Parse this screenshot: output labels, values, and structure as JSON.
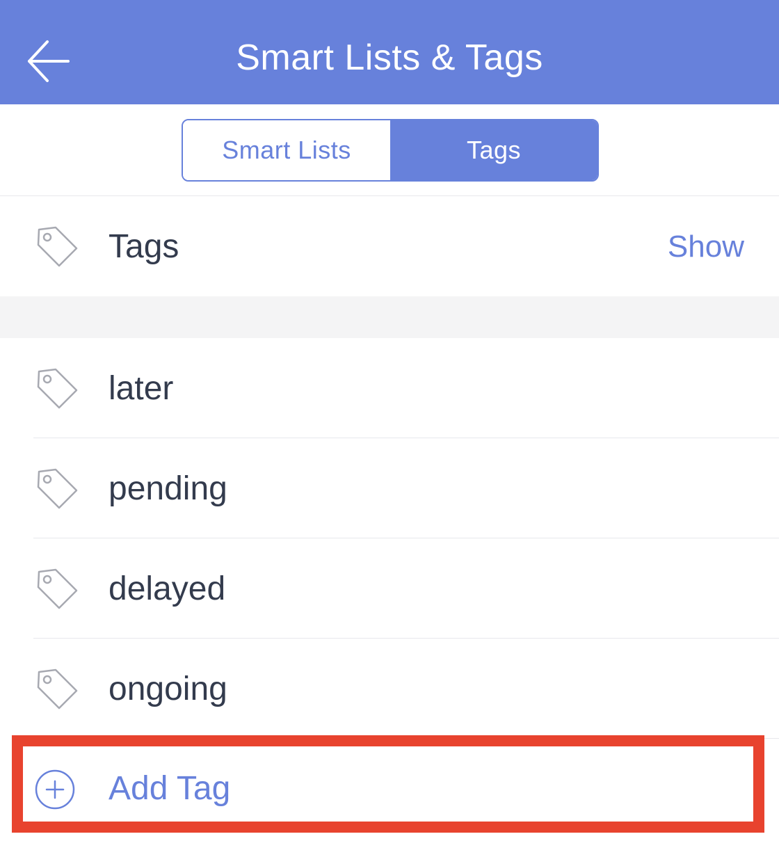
{
  "header": {
    "title": "Smart Lists & Tags",
    "back_icon": "arrow-left-icon",
    "background_color": "#6781db"
  },
  "segmented_control": {
    "options": [
      {
        "label": "Smart Lists",
        "selected": false
      },
      {
        "label": "Tags",
        "selected": true
      }
    ]
  },
  "tags_section": {
    "label": "Tags",
    "action_label": "Show",
    "icon": "tag-icon"
  },
  "tag_list": {
    "items": [
      {
        "label": "later",
        "icon": "tag-icon"
      },
      {
        "label": "pending",
        "icon": "tag-icon"
      },
      {
        "label": "delayed",
        "icon": "tag-icon"
      },
      {
        "label": "ongoing",
        "icon": "tag-icon"
      }
    ]
  },
  "add_tag": {
    "label": "Add Tag",
    "icon": "plus-circle-icon"
  },
  "colors": {
    "accent": "#6781db",
    "text_primary": "#333b4d",
    "icon_gray": "#a7a9b1",
    "highlight": "#e8432e"
  }
}
